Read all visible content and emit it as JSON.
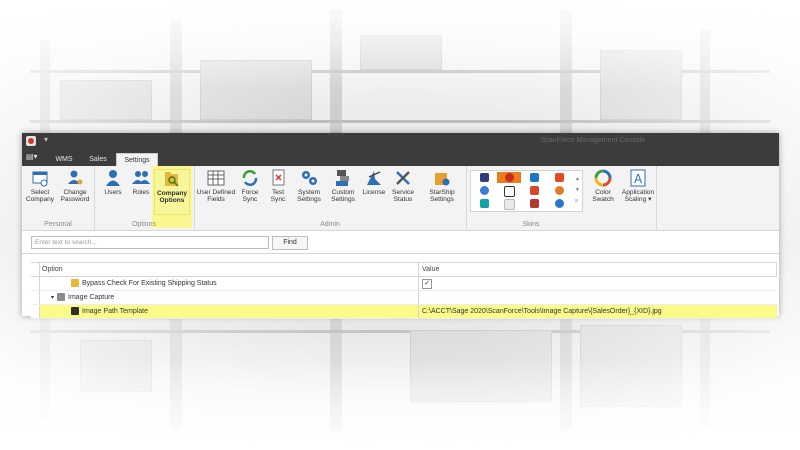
{
  "window": {
    "title": "ScanForce Management Console"
  },
  "tabs": [
    "WMS",
    "Sales",
    "Settings"
  ],
  "active_tab": "Settings",
  "ribbon": {
    "groups": [
      {
        "label": "Personal",
        "buttons": [
          "Select\nCompany",
          "Change\nPassword"
        ]
      },
      {
        "label": "Options",
        "buttons": [
          "Users",
          "Roles",
          "Company\nOptions"
        ]
      },
      {
        "label": "Admin",
        "buttons": [
          "User Defined\nFields",
          "Force\nSync",
          "Test\nSync",
          "System\nSettings",
          "Custom\nSettings",
          "License",
          "Service\nStatus",
          "StarShip\nSettings"
        ]
      },
      {
        "label": "Skins",
        "buttons": [
          "Color\nSwatch",
          "Application\nScaling ▾"
        ]
      }
    ]
  },
  "search": {
    "placeholder": "Enter text to search...",
    "find_label": "Find"
  },
  "grid": {
    "headers": {
      "option": "Option",
      "value": "Value"
    },
    "rows": [
      {
        "label": "Bypass Check For Existing Shipping Status",
        "value": "✓"
      },
      {
        "label": "Image Capture",
        "value": ""
      },
      {
        "label": "Image Path Template",
        "value": "C:\\ACCT\\Sage 2020\\ScanForce\\Tools\\Image Capture\\{SalesOrder}_{XID}.jpg"
      }
    ]
  },
  "colors": {
    "titlebar": "#3c3c3c",
    "highlight": "#fbfb8a",
    "ribbon": "#f3f3f3",
    "selected_skin": "#ee7b1b"
  }
}
